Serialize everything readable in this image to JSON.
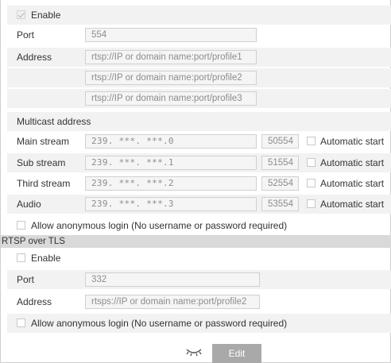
{
  "rtsp": {
    "enable_label": "Enable",
    "enable_checked": true,
    "port_label": "Port",
    "port_value": "554",
    "address_label": "Address",
    "addresses": [
      "rtsp://IP or domain name:port/profile1",
      "rtsp://IP or domain name:port/profile2",
      "rtsp://IP or domain name:port/profile3"
    ],
    "multicast_label": "Multicast address",
    "streams": [
      {
        "label": "Main stream",
        "ip": "239. ***. ***.0",
        "port": "50554",
        "auto": "Automatic start"
      },
      {
        "label": "Sub stream",
        "ip": "239. ***. ***.1",
        "port": "51554",
        "auto": "Automatic start"
      },
      {
        "label": "Third stream",
        "ip": "239. ***. ***.2",
        "port": "52554",
        "auto": "Automatic start"
      },
      {
        "label": "Audio",
        "ip": "239. ***. ***.3",
        "port": "53554",
        "auto": "Automatic start"
      }
    ],
    "anonymous_label": "Allow anonymous login (No username or password required)"
  },
  "tls": {
    "section_title": "RTSP over TLS",
    "enable_label": "Enable",
    "port_label": "Port",
    "port_value": "332",
    "address_label": "Address",
    "address_value": "rtsps://IP or domain name:port/profile2",
    "anonymous_label": "Allow anonymous login (No username or password required)"
  },
  "footer": {
    "edit_label": "Edit",
    "eye_icon": "eye-closed-icon"
  },
  "colors": {
    "row_shade": "#f2f2f2",
    "section_header": "#d9d9d9",
    "button_bg": "#a9a9a9"
  }
}
